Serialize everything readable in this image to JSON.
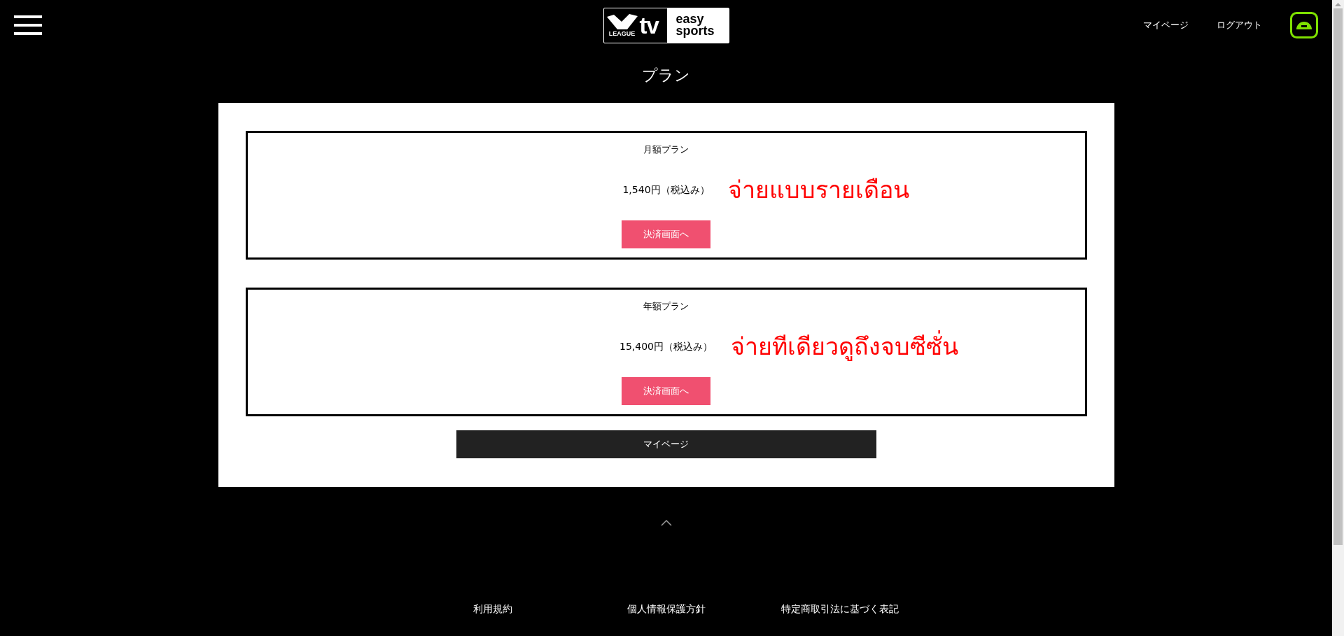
{
  "header": {
    "logo": {
      "mark_text": "LEAGUE",
      "main_text": "tv",
      "side_lines": [
        "easy",
        "sports"
      ]
    },
    "links": [
      "マイページ",
      "ログアウト"
    ]
  },
  "page_title": "プラン",
  "plans": [
    {
      "name": "月額プラン",
      "price": "1,540円（税込み）",
      "annotation": "จ่ายแบบรายเดือน",
      "button": "決済画面へ"
    },
    {
      "name": "年額プラン",
      "price": "15,400円（税込み）",
      "annotation": "จ่ายทีเดียวดูถึงจบซีซั่น",
      "button": "決済画面へ"
    }
  ],
  "mypage_button": "マイページ",
  "footer_links": [
    "利用規約",
    "個人情報保護方針",
    "特定商取引法に基づく表記"
  ]
}
